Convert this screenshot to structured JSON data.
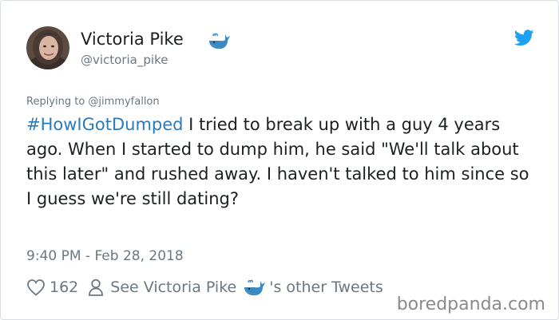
{
  "tweet": {
    "author": {
      "display_name": "Victoria Pike",
      "handle": "@victoria_pike"
    },
    "reply_to": "Replying to @jimmyfallon",
    "hashtag": "#HowIGotDumped",
    "text": " I tried to break up with a guy 4 years ago. When I started to dump him, he said \"We'll talk about this later\" and rushed away. I haven't talked to him since so I guess we're still dating?",
    "timestamp": "9:40 PM - Feb 28, 2018",
    "like_count": "162",
    "see_other_prefix": "See Victoria Pike",
    "see_other_suffix": "'s other Tweets"
  },
  "icons": {
    "like": "heart-icon",
    "profile": "person-icon",
    "brand": "twitter-bird-icon",
    "emoji": "whale-emoji"
  },
  "watermark": "boredpanda.com",
  "colors": {
    "hashtag": "#2b7bb9",
    "twitter_blue": "#1da1f2",
    "whale_blue": "#3b88c3",
    "secondary_text": "#697882"
  }
}
